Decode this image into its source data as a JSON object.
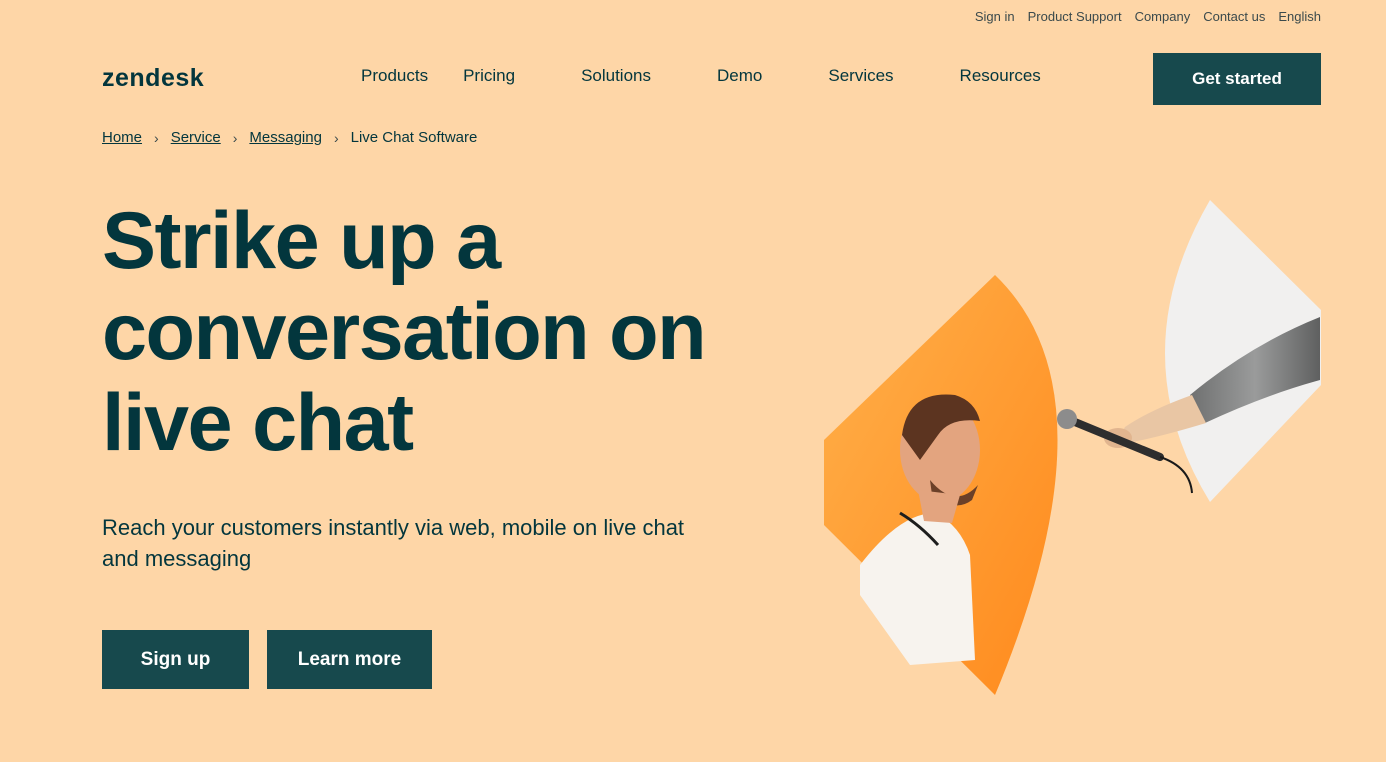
{
  "utility_nav": [
    "Sign in",
    "Product Support",
    "Company",
    "Contact us",
    "English"
  ],
  "logo": "zendesk",
  "main_nav": [
    "Products",
    "Pricing",
    "Solutions",
    "Demo",
    "Services",
    "Resources"
  ],
  "cta": "Get started",
  "breadcrumb": {
    "home": "Home",
    "service": "Service",
    "messaging": "Messaging",
    "current": "Live Chat Software",
    "sep": "›"
  },
  "hero": {
    "title_line1": "Strike up a",
    "title_line2": "conversation on",
    "title_line3": "live chat",
    "subtitle": "Reach your customers instantly via web, mobile on live chat and messaging",
    "signup": "Sign up",
    "learn_more": "Learn more"
  },
  "colors": {
    "background": "#fed6a7",
    "primary": "#17494d",
    "text": "#03363d",
    "accent": "#ff8a1d"
  }
}
